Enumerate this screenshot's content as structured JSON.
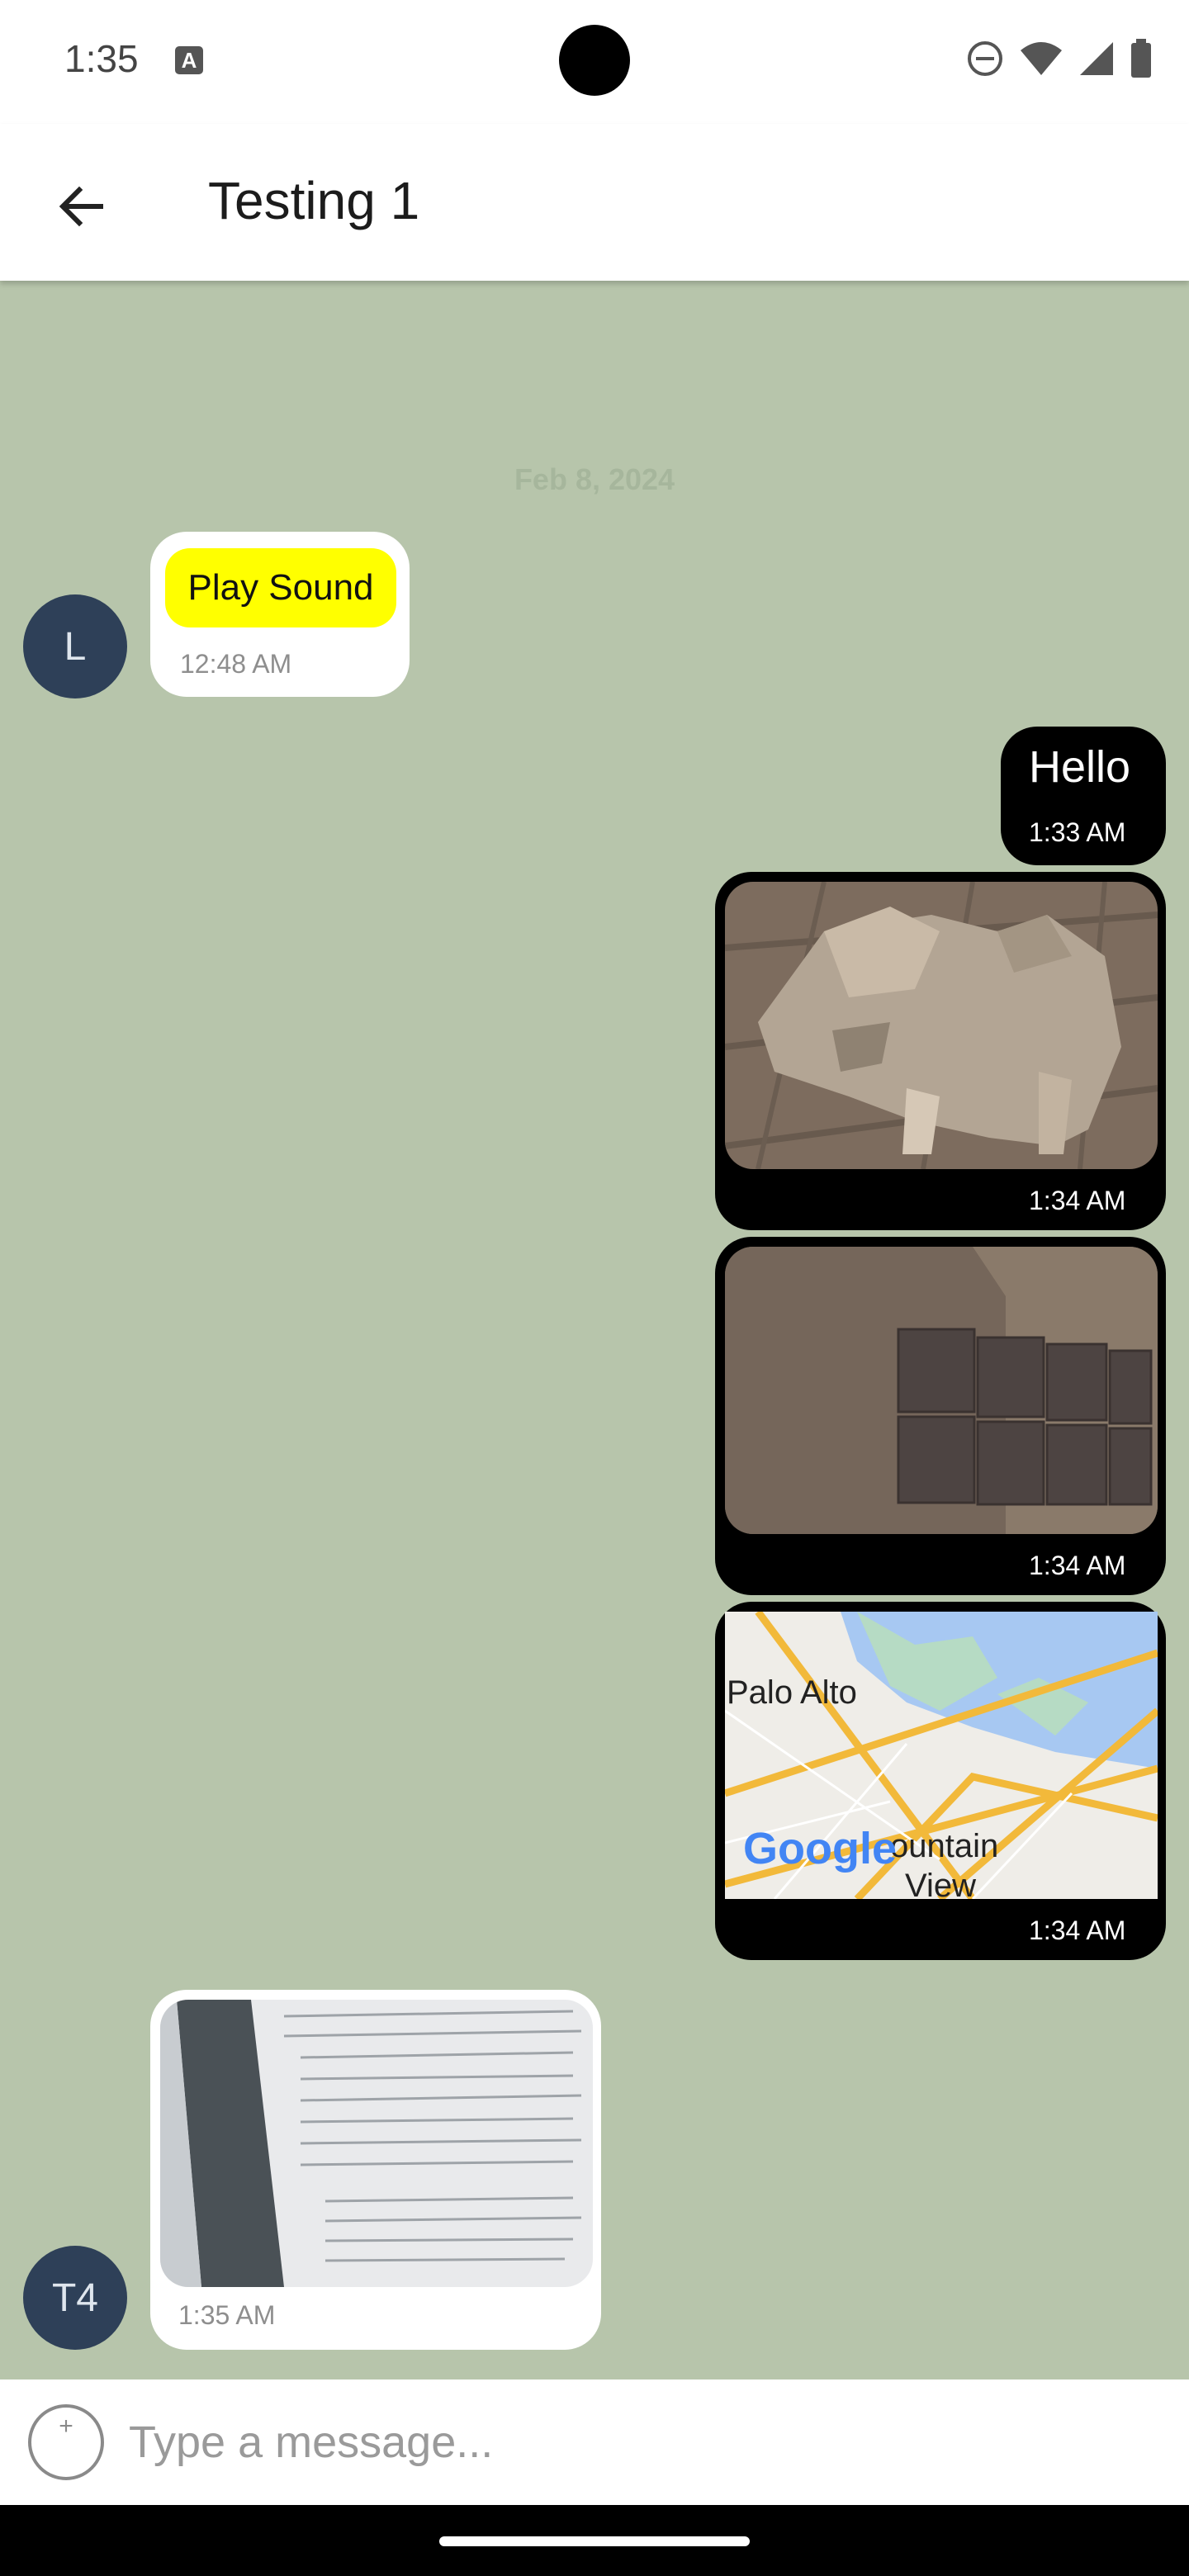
{
  "status_bar": {
    "time": "1:35",
    "icons": [
      "a-notification-icon",
      "do-not-disturb-icon",
      "wifi-icon",
      "signal-icon",
      "battery-icon"
    ]
  },
  "header": {
    "back_icon": "arrow-left-icon",
    "title": "Testing 1"
  },
  "chat": {
    "date_separator": "Feb 8, 2024",
    "messages": [
      {
        "direction": "incoming",
        "avatar": "L",
        "type": "button",
        "button_label": "Play Sound",
        "time": "12:48 AM"
      },
      {
        "direction": "outgoing",
        "type": "text",
        "text": "Hello",
        "time": "1:33 AM"
      },
      {
        "direction": "outgoing",
        "type": "image",
        "image": "low-poly-dog-photo",
        "time": "1:34 AM"
      },
      {
        "direction": "outgoing",
        "type": "image",
        "image": "wall-acoustic-panels-photo",
        "time": "1:34 AM"
      },
      {
        "direction": "outgoing",
        "type": "map",
        "map_labels": {
          "city_1": "Palo Alto",
          "city_2": "ountain",
          "city_2_line2": "View",
          "logo": "Google"
        },
        "time": "1:34 AM"
      },
      {
        "direction": "incoming",
        "avatar": "T4",
        "type": "image",
        "image": "document-screen-photo",
        "time": "1:35 AM"
      }
    ]
  },
  "composer": {
    "attach_icon": "add-circle-icon",
    "attach_glyph": "+",
    "placeholder": "Type a message..."
  },
  "colors": {
    "chat_background": "#b7c5ab",
    "incoming_bubble": "#ffffff",
    "outgoing_bubble": "#000000",
    "play_button": "#ffff00",
    "avatar": "#2e4058"
  }
}
